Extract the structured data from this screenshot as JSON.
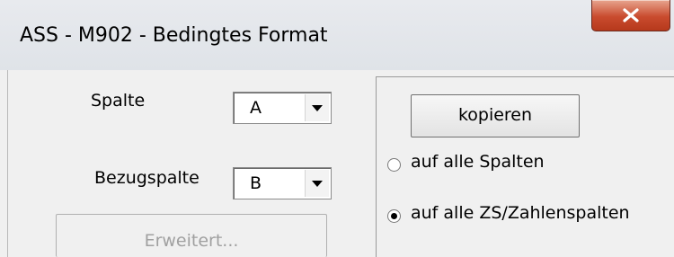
{
  "window": {
    "title": "ASS - M902 - Bedingtes Format"
  },
  "form": {
    "spalte_label": "Spalte",
    "spalte_value": "A",
    "bezugspalte_label": "Bezugspalte",
    "bezugspalte_value": "B",
    "erweitert_label": "Erweitert..."
  },
  "copy_group": {
    "kopieren_label": "kopieren",
    "options": [
      {
        "label": "auf alle Spalten",
        "selected": false
      },
      {
        "label": "auf alle ZS/Zahlenspalten",
        "selected": true
      }
    ]
  },
  "colors": {
    "close_button": "#c94b2e",
    "dialog_background": "#f0f0f0",
    "disabled_text": "#a0a0a0"
  }
}
